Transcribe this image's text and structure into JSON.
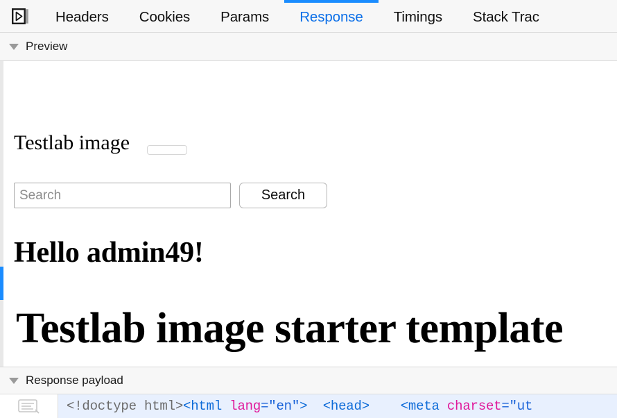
{
  "tabbar": {
    "step_icon_name": "step-over-icon",
    "tabs": [
      {
        "label": "Headers",
        "active": false
      },
      {
        "label": "Cookies",
        "active": false
      },
      {
        "label": "Params",
        "active": false
      },
      {
        "label": "Response",
        "active": true
      },
      {
        "label": "Timings",
        "active": false
      },
      {
        "label": "Stack Trac",
        "active": false
      }
    ],
    "active_color": "#0b6fe8",
    "active_underline_color": "#1a8cff"
  },
  "preview_section": {
    "title": "Preview",
    "twisty": "chevron-down-icon",
    "expanded": true
  },
  "preview_document": {
    "page_heading": "Testlab image",
    "search": {
      "placeholder": "Search",
      "value": "",
      "button_label": "Search"
    },
    "greeting": "Hello admin49!",
    "main_title": "Testlab image starter template"
  },
  "payload_section": {
    "title": "Response payload",
    "twisty": "chevron-down-icon",
    "expanded": true,
    "gutter_icon": "pretty-print-icon",
    "code_line": {
      "full_text": "<!doctype html><html lang=\"en\">  <head>    <meta charset=\"ut",
      "tokens": [
        {
          "text": "<!doctype html>",
          "type": "doctype"
        },
        {
          "text": "<html",
          "type": "tag"
        },
        {
          "text": " lang",
          "type": "attr"
        },
        {
          "text": "=",
          "type": "punc"
        },
        {
          "text": "\"en\"",
          "type": "val"
        },
        {
          "text": ">",
          "type": "tag"
        },
        {
          "text": "  ",
          "type": "punc"
        },
        {
          "text": "<head>",
          "type": "tag"
        },
        {
          "text": "    ",
          "type": "punc"
        },
        {
          "text": "<meta",
          "type": "tag"
        },
        {
          "text": " charset",
          "type": "attr"
        },
        {
          "text": "=",
          "type": "punc"
        },
        {
          "text": "\"ut",
          "type": "val"
        }
      ]
    }
  },
  "colors": {
    "accent_blue": "#1a8cff",
    "link_blue": "#0b6fe8",
    "chrome_grey": "#f7f7f7",
    "code_bg": "#e8f0fe",
    "tag_blue": "#0d6bd8",
    "attr_pink": "#e0189a"
  }
}
